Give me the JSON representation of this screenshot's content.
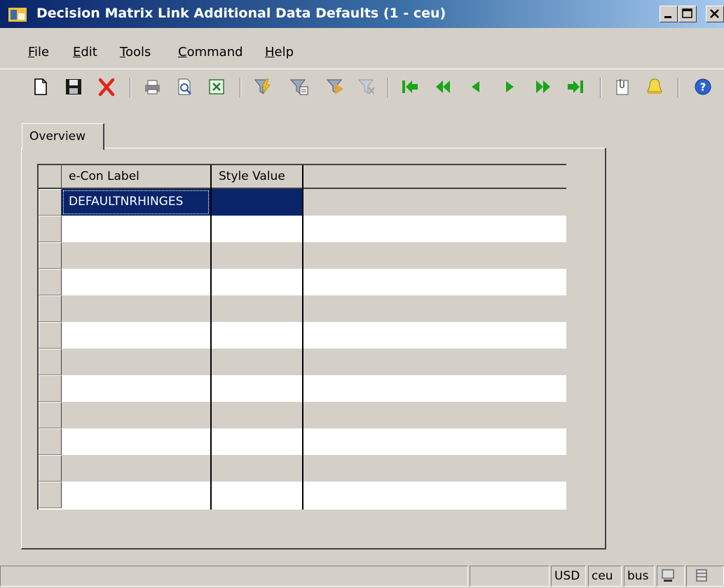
{
  "window": {
    "title": "Decision Matrix Link Additional Data Defaults (1 - ceu)"
  },
  "menu": [
    {
      "label": "File",
      "accel": "F",
      "rest": "ile"
    },
    {
      "label": "Edit",
      "accel": "E",
      "rest": "dit"
    },
    {
      "label": "Tools",
      "accel": "T",
      "rest": "ools"
    },
    {
      "label": "Command",
      "accel": "C",
      "rest": "ommand"
    },
    {
      "label": "Help",
      "accel": "H",
      "rest": "elp"
    }
  ],
  "toolbar": {
    "icons": [
      "new-record-icon",
      "save-icon",
      "delete-icon",
      "print-icon",
      "print-preview-icon",
      "export-excel-icon",
      "filter-lightning-icon",
      "filter-by-form-icon",
      "filter-by-selection-icon",
      "clear-filter-icon",
      "first-record-icon",
      "previous-page-icon",
      "previous-record-icon",
      "next-record-icon",
      "next-page-icon",
      "last-record-icon",
      "attachments-icon",
      "alert-icon",
      "help-icon"
    ]
  },
  "tabs": [
    {
      "label": "Overview"
    }
  ],
  "grid": {
    "columns": [
      "e-Con Label",
      "Style Value",
      ""
    ],
    "rows": [
      {
        "label": "DEFAULTNRHINGES",
        "value": ""
      },
      {
        "label": "",
        "value": ""
      },
      {
        "label": "",
        "value": ""
      },
      {
        "label": "",
        "value": ""
      },
      {
        "label": "",
        "value": ""
      },
      {
        "label": "",
        "value": ""
      },
      {
        "label": "",
        "value": ""
      },
      {
        "label": "",
        "value": ""
      },
      {
        "label": "",
        "value": ""
      },
      {
        "label": "",
        "value": ""
      },
      {
        "label": "",
        "value": ""
      },
      {
        "label": "",
        "value": ""
      }
    ]
  },
  "status": {
    "currency": "USD",
    "company": "ceu",
    "layer": "bus"
  },
  "colors": {
    "selection": "#0a246a",
    "titlebar_start": "#0a246a",
    "titlebar_end": "#a6caf0",
    "face": "#d4d0c8"
  }
}
